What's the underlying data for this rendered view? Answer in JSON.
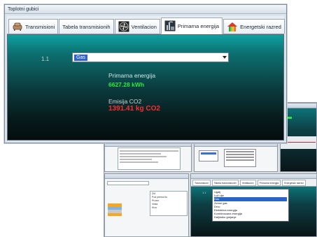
{
  "window": {
    "title": "Toplotni gubici"
  },
  "tabs": [
    {
      "label": "Transmisioni",
      "icon": "sofa-icon"
    },
    {
      "label": "Tabela transmisionih",
      "icon": ""
    },
    {
      "label": "Ventilacion",
      "icon": "fan-icon"
    },
    {
      "label": "Primarna energija",
      "icon": "power-plant-icon"
    },
    {
      "label": "Energetski razred",
      "icon": "energy-house-icon"
    }
  ],
  "active_tab": 3,
  "primary": {
    "row_label": "1.1",
    "select_value": "Gas",
    "energy_label": "Primarna energija",
    "energy_value": "6627.28 kWh",
    "co2_label": "Emisija CO2",
    "co2_value": "1391.41 kg CO2"
  },
  "colors": {
    "energy_value": "#2fe83c",
    "co2_value": "#ff2b2b",
    "selection": "#2f63c7"
  },
  "collage": {
    "lower_right_tabs": [
      "Transmisioni",
      "Tabela transmisionih",
      "Ventilacion",
      "Primarna energija",
      "Energetski razred"
    ],
    "lower_right_row": "1.1",
    "lower_right_options": [
      "Ugalj",
      "Lož ulje",
      "Gas",
      "Zemni gas",
      "Drvo",
      "Električna energija",
      "Kombinovana energija",
      "Daljinsko grejanje"
    ],
    "lower_right_selected": 2,
    "lower_left_tree": [
      "Zid",
      "Pod prema tlu",
      "Prozor",
      "Vrata",
      "Krov"
    ]
  }
}
